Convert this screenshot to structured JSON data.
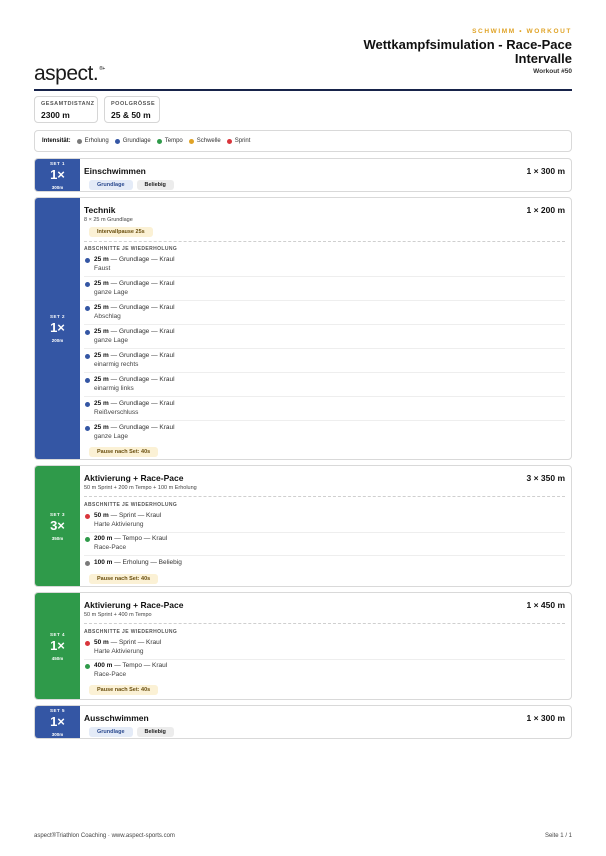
{
  "header": {
    "logo": "aspect.",
    "logo_mark": "®+",
    "kicker": "SCHWIMM • WORKOUT",
    "title_line1": "Wettkampfsimulation - Race-Pace",
    "title_line2": "Intervalle",
    "workout_number": "Workout #50"
  },
  "stats": [
    {
      "label": "GESAMTDISTANZ",
      "value": "2300 m"
    },
    {
      "label": "POOLGRÖSSE",
      "value": "25 & 50 m"
    }
  ],
  "legend": {
    "title": "Intensität:",
    "items": [
      {
        "label": "Erholung",
        "color": "#7a7a7a"
      },
      {
        "label": "Grundlage",
        "color": "#3456a4"
      },
      {
        "label": "Tempo",
        "color": "#2f9a4a"
      },
      {
        "label": "Schwelle",
        "color": "#e0a326"
      },
      {
        "label": "Sprint",
        "color": "#d9353b"
      }
    ]
  },
  "section_label": "ABSCHNITTE JE WIEDERHOLUNG",
  "sets": [
    {
      "set_label": "SET 1",
      "count": "1×",
      "distance": "300m",
      "name": "Einschwimmen",
      "total": "1 × 300 m",
      "chips": [
        "Grundlage",
        "Beliebig"
      ]
    },
    {
      "set_label": "SET 2",
      "count": "1×",
      "distance": "200m",
      "name": "Technik",
      "total": "1 × 200 m",
      "subtitle": "8 × 25 m Grundlage",
      "interval_pause": "Intervallpause 25s",
      "items": [
        {
          "main": "25 m",
          "desc": " — Grundlage — Kraul",
          "detail": "Faust",
          "color": "#3456a4"
        },
        {
          "main": "25 m",
          "desc": " — Grundlage — Kraul",
          "detail": "ganze Lage",
          "color": "#3456a4"
        },
        {
          "main": "25 m",
          "desc": " — Grundlage — Kraul",
          "detail": "Abschlag",
          "color": "#3456a4"
        },
        {
          "main": "25 m",
          "desc": " — Grundlage — Kraul",
          "detail": "ganze Lage",
          "color": "#3456a4"
        },
        {
          "main": "25 m",
          "desc": " — Grundlage — Kraul",
          "detail": "einarmig rechts",
          "color": "#3456a4"
        },
        {
          "main": "25 m",
          "desc": " — Grundlage — Kraul",
          "detail": "einarmig links",
          "color": "#3456a4"
        },
        {
          "main": "25 m",
          "desc": " — Grundlage — Kraul",
          "detail": "Reißverschluss",
          "color": "#3456a4"
        },
        {
          "main": "25 m",
          "desc": " — Grundlage — Kraul",
          "detail": "ganze Lage",
          "color": "#3456a4"
        }
      ],
      "pause": "Pause nach Set: 40s"
    },
    {
      "set_label": "SET 3",
      "count": "3×",
      "distance": "350m",
      "name": "Aktivierung + Race-Pace",
      "total": "3 × 350 m",
      "subtitle": "50 m Sprint + 200 m Tempo + 100 m Erholung",
      "items": [
        {
          "main": "50 m",
          "desc": " — Sprint — Kraul",
          "detail": "Harte Aktivierung",
          "color": "#d9353b"
        },
        {
          "main": "200 m",
          "desc": " — Tempo — Kraul",
          "detail": "Race-Pace",
          "color": "#2f9a4a"
        },
        {
          "main": "100 m",
          "desc": " — Erholung — Beliebig",
          "detail": "",
          "color": "#7a7a7a"
        }
      ],
      "pause": "Pause nach Set: 40s"
    },
    {
      "set_label": "SET 4",
      "count": "1×",
      "distance": "450m",
      "name": "Aktivierung + Race-Pace",
      "total": "1 × 450 m",
      "subtitle": "50 m Sprint + 400 m Tempo",
      "items": [
        {
          "main": "50 m",
          "desc": " — Sprint — Kraul",
          "detail": "Harte Aktivierung",
          "color": "#d9353b"
        },
        {
          "main": "400 m",
          "desc": " — Tempo — Kraul",
          "detail": "Race-Pace",
          "color": "#2f9a4a"
        }
      ],
      "pause": "Pause nach Set: 40s"
    },
    {
      "set_label": "SET 5",
      "count": "1×",
      "distance": "300m",
      "name": "Ausschwimmen",
      "total": "1 × 300 m",
      "chips": [
        "Grundlage",
        "Beliebig"
      ]
    }
  ],
  "footer": {
    "left": "aspect®Triathlon Coaching · www.aspect-sports.com",
    "right": "Seite 1 / 1"
  }
}
